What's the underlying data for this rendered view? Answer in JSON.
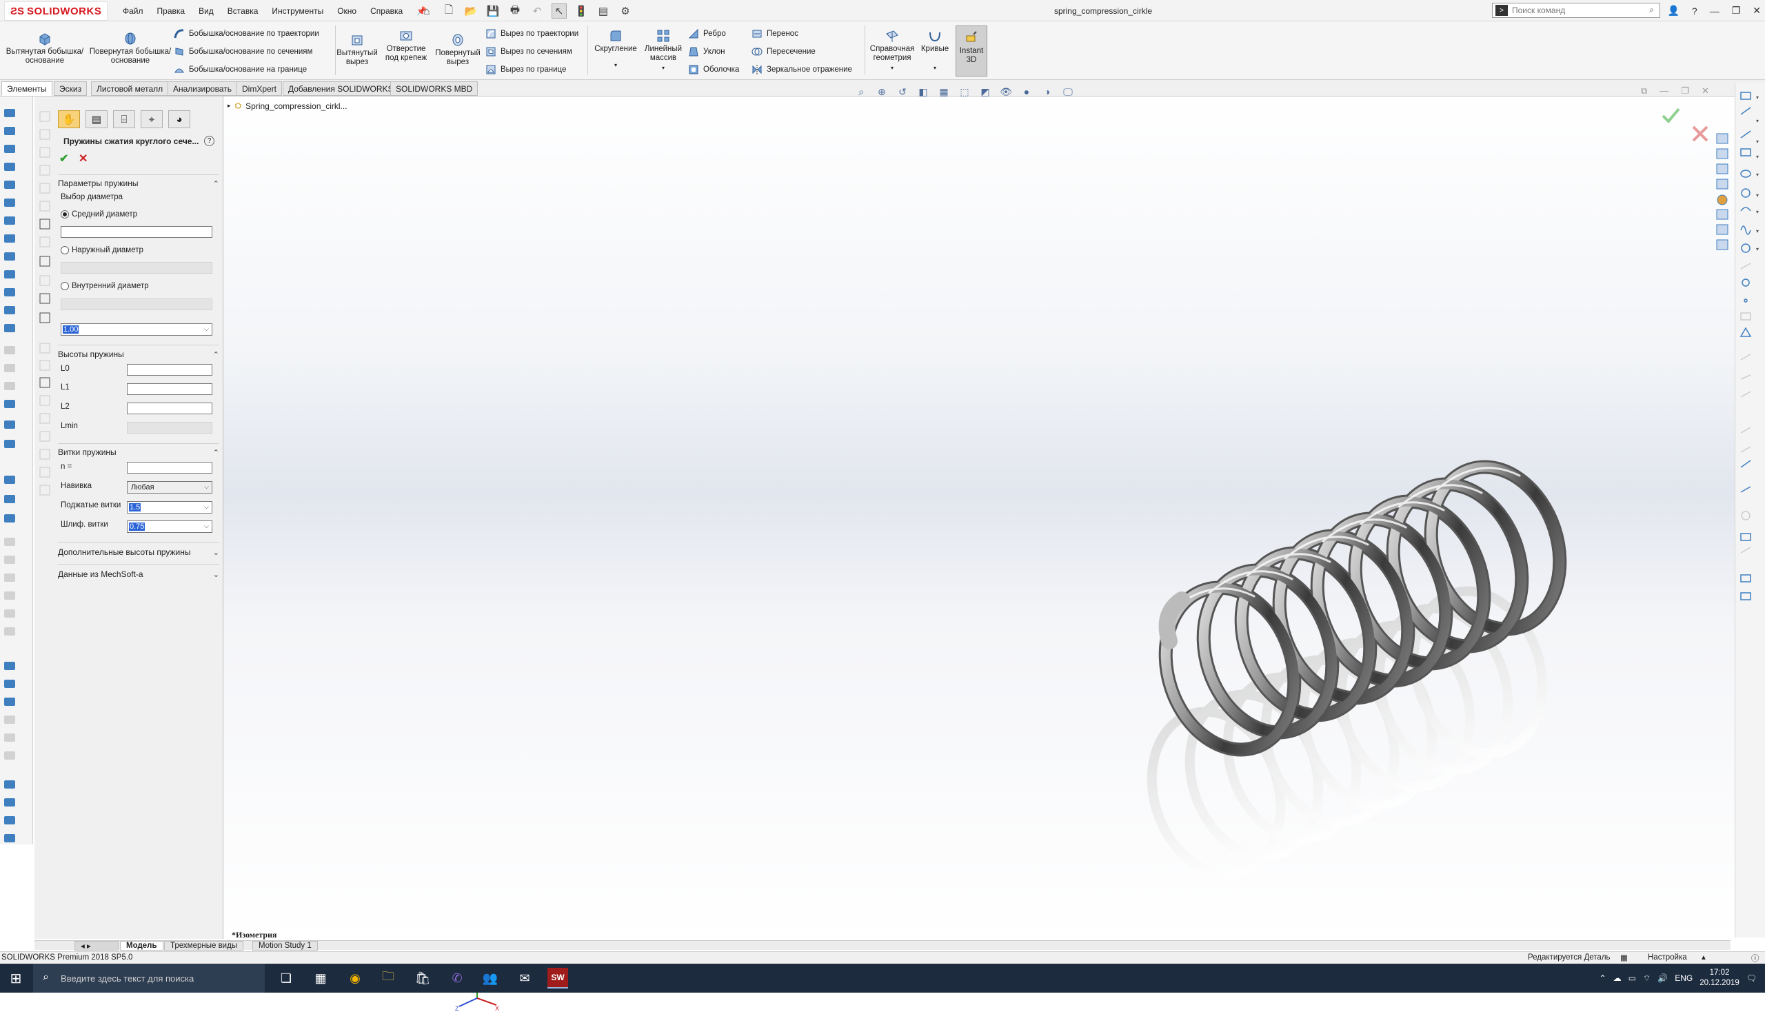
{
  "app": {
    "logo": "SOLIDWORKS",
    "document_title": "spring_compression_cirkle"
  },
  "menu": [
    "Файл",
    "Правка",
    "Вид",
    "Вставка",
    "Инструменты",
    "Окно",
    "Справка"
  ],
  "search": {
    "placeholder": "Поиск команд",
    "shortcut_icon": "command-icon"
  },
  "ribbon": {
    "extruded_boss": "Вытянутая бобышка/основание",
    "revolved_boss": "Повернутая бобышка/основание",
    "swept_boss": "Бобышка/основание по траектории",
    "lofted_boss": "Бобышка/основание по сечениям",
    "boundary_boss": "Бобышка/основание на границе",
    "extruded_cut": "Вытянутый вырез",
    "hole_wizard": "Отверстие под крепеж",
    "revolved_cut": "Повернутый вырез",
    "swept_cut": "Вырез по траектории",
    "lofted_cut": "Вырез по сечениям",
    "boundary_cut": "Вырез по границе",
    "fillet": "Скругление",
    "linear_pattern": "Линейный массив",
    "rib": "Ребро",
    "draft": "Уклон",
    "shell": "Оболочка",
    "wrap": "Перенос",
    "intersect": "Пересечение",
    "mirror": "Зеркальное отражение",
    "ref_geometry": "Справочная геометрия",
    "curves": "Кривые",
    "instant3d": "Instant 3D"
  },
  "tabs": [
    "Элементы",
    "Эскиз",
    "Листовой металл",
    "Анализировать",
    "DimXpert",
    "Добавления SOLIDWORKS",
    "SOLIDWORKS MBD"
  ],
  "property_manager": {
    "title": "Пружины сжатия круглого сече...",
    "help": "?",
    "ok": "✔",
    "cancel": "✕",
    "section_params": "Параметры пружины",
    "diameter_choice": "Выбор диаметра",
    "mean_diameter": "Средний диаметр",
    "outer_diameter": "Наружный диаметр",
    "inner_diameter": "Внутренний диаметр",
    "wire_value": "1.00",
    "section_heights": "Высоты пружины",
    "l0": "L0",
    "l1": "L1",
    "l2": "L2",
    "lmin": "Lmin",
    "section_coils": "Витки пружины",
    "n_label": "n =",
    "winding_label": "Навивка",
    "winding_value": "Любая",
    "closed_coils_label": "Поджатые витки",
    "closed_coils_value": "1.5",
    "ground_coils_label": "Шлиф. витки",
    "ground_coils_value": "0.75",
    "section_extra_heights": "Дополнительные высоты пружины",
    "section_mechsoft": "Данные из MechSoft-a"
  },
  "tree": {
    "item": "Spring_compression_cirkl..."
  },
  "viewport": {
    "view_label": "*Изометрия"
  },
  "bottom_tabs": [
    "Модель",
    "Трехмерные виды",
    "Motion Study 1"
  ],
  "status": {
    "left": "SOLIDWORKS Premium 2018 SP5.0",
    "editing": "Редактируется Деталь",
    "settings": "Настройка"
  },
  "taskbar": {
    "search_placeholder": "Введите здесь текст для поиска",
    "lang": "ENG",
    "time": "17:02",
    "date": "20.12.2019"
  },
  "colors": {
    "brand_red": "#d71920",
    "taskbar": "#1c2b3e",
    "selection_blue": "#2a64d6",
    "accept_green": "#2e9e2e",
    "cancel_red": "#cc2222"
  }
}
